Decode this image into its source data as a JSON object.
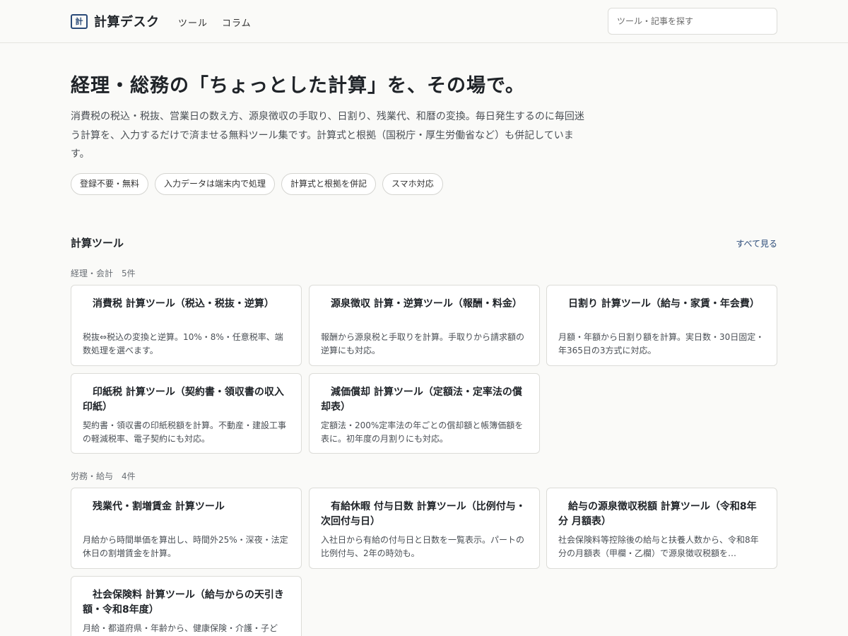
{
  "header": {
    "logo_mark": "計",
    "site_name": "計算デスク",
    "nav": [
      "ツール",
      "コラム"
    ],
    "search_placeholder": "ツール・記事を探す"
  },
  "hero": {
    "title": "経理・総務の「ちょっとした計算」を、その場で。",
    "description": "消費税の税込・税抜、営業日の数え方、源泉徴収の手取り、日割り、残業代、和暦の変換。毎日発生するのに毎回迷う計算を、入力するだけで済ませる無料ツール集です。計算式と根拠（国税庁・厚生労働省など）も併記しています。",
    "chips": [
      "登録不要・無料",
      "入力データは端末内で処理",
      "計算式と根拠を併記",
      "スマホ対応"
    ]
  },
  "tools": {
    "section_title": "計算ツール",
    "see_all": "すべて見る",
    "categories": [
      {
        "label": "経理・会計　5件",
        "cards": [
          {
            "title": "消費税 計算ツール（税込・税抜・逆算）",
            "desc": "税抜⇔税込の変換と逆算。10%・8%・任意税率、端数処理を選べます。"
          },
          {
            "title": "源泉徴収 計算・逆算ツール（報酬・料金）",
            "desc": "報酬から源泉税と手取りを計算。手取りから請求額の逆算にも対応。"
          },
          {
            "title": "日割り 計算ツール（給与・家賃・年会費）",
            "desc": "月額・年額から日割り額を計算。実日数・30日固定・年365日の3方式に対応。"
          },
          {
            "title": "印紙税 計算ツール（契約書・領収書の収入印紙）",
            "desc": "契約書・領収書の印紙税額を計算。不動産・建設工事の軽減税率、電子契約にも対応。"
          },
          {
            "title": "減価償却 計算ツール（定額法・定率法の償却表）",
            "desc": "定額法・200%定率法の年ごとの償却額と帳簿価額を表に。初年度の月割りにも対応。"
          }
        ]
      },
      {
        "label": "労務・給与　4件",
        "cards": [
          {
            "title": "残業代・割増賃金 計算ツール",
            "desc": "月給から時間単価を算出し、時間外25%・深夜・法定休日の割増賃金を計算。"
          },
          {
            "title": "有給休暇 付与日数 計算ツール（比例付与・次回付与日）",
            "desc": "入社日から有給の付与日と日数を一覧表示。パートの比例付与、2年の時効も。"
          },
          {
            "title": "給与の源泉徴収税額 計算ツール（令和8年分 月額表）",
            "desc": "社会保険料等控除後の給与と扶養人数から、令和8年分の月額表（甲欄・乙欄）で源泉徴収税額を…"
          },
          {
            "title": "社会保険料 計算ツール（給与からの天引き額・令和8年度）",
            "desc": "月給・都道府県・年齢から、健康保険・介護・子ども・子育て支援金・厚生年金・雇用保険の天引き額を計算。"
          }
        ]
      }
    ]
  }
}
